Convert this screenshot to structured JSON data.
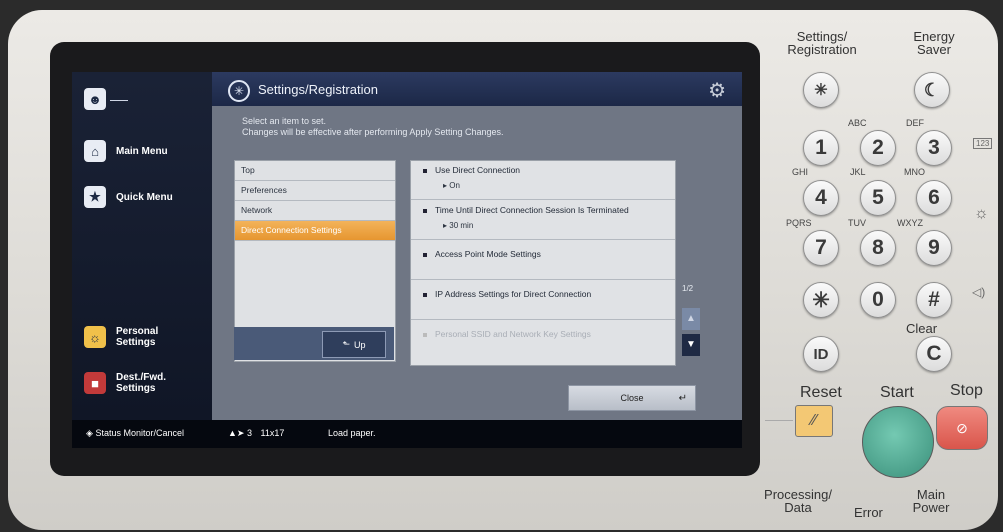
{
  "sidebar": {
    "user_icon": "user-icon",
    "main_menu": "Main Menu",
    "quick_menu": "Quick Menu",
    "personal_settings_line1": "Personal",
    "personal_settings_line2": "Settings",
    "dest_fwd_line1": "Dest./Fwd.",
    "dest_fwd_line2": "Settings"
  },
  "window": {
    "title": "Settings/Registration",
    "instruction_line1": "Select an item to set.",
    "instruction_line2": "Changes will be effective after performing Apply Setting Changes.",
    "nav": [
      {
        "label": "Top",
        "active": false
      },
      {
        "label": "Preferences",
        "active": false
      },
      {
        "label": "Network",
        "active": false
      },
      {
        "label": "Direct Connection Settings",
        "active": true
      }
    ],
    "up_label": "Up",
    "items": [
      {
        "label": "Use Direct Connection",
        "value": "On"
      },
      {
        "label": "Time Until Direct Connection Session Is Terminated",
        "value": "30 min"
      },
      {
        "label": "Access Point Mode Settings",
        "value": ""
      },
      {
        "label": "IP Address Settings for Direct Connection",
        "value": ""
      },
      {
        "label": "Personal SSID and Network Key Settings",
        "value": ""
      }
    ],
    "page_indicator": "1/2",
    "close_label": "Close"
  },
  "status_bar": {
    "status_monitor": "Status Monitor/Cancel",
    "paper_count": "3",
    "paper_size": "11x17",
    "message": "Load paper."
  },
  "hardkeys": {
    "settings_registration_line1": "Settings/",
    "settings_registration_line2": "Registration",
    "energy_saver_line1": "Energy",
    "energy_saver_line2": "Saver",
    "keys": [
      {
        "digit": "1",
        "letters": ""
      },
      {
        "digit": "2",
        "letters": "ABC"
      },
      {
        "digit": "3",
        "letters": "DEF"
      },
      {
        "digit": "4",
        "letters": "GHI"
      },
      {
        "digit": "5",
        "letters": "JKL"
      },
      {
        "digit": "6",
        "letters": "MNO"
      },
      {
        "digit": "7",
        "letters": "PQRS"
      },
      {
        "digit": "8",
        "letters": "TUV"
      },
      {
        "digit": "9",
        "letters": "WXYZ"
      },
      {
        "digit": "0",
        "letters": ""
      }
    ],
    "star": "✳",
    "hash": "#",
    "id_key": "ID",
    "clear_key": "C",
    "clear_label": "Clear",
    "reset_label": "Reset",
    "start_label": "Start",
    "stop_label": "Stop",
    "processing_line1": "Processing/",
    "processing_line2": "Data",
    "error_label": "Error",
    "main_power_line1": "Main",
    "main_power_line2": "Power",
    "counter_icon": "123"
  }
}
